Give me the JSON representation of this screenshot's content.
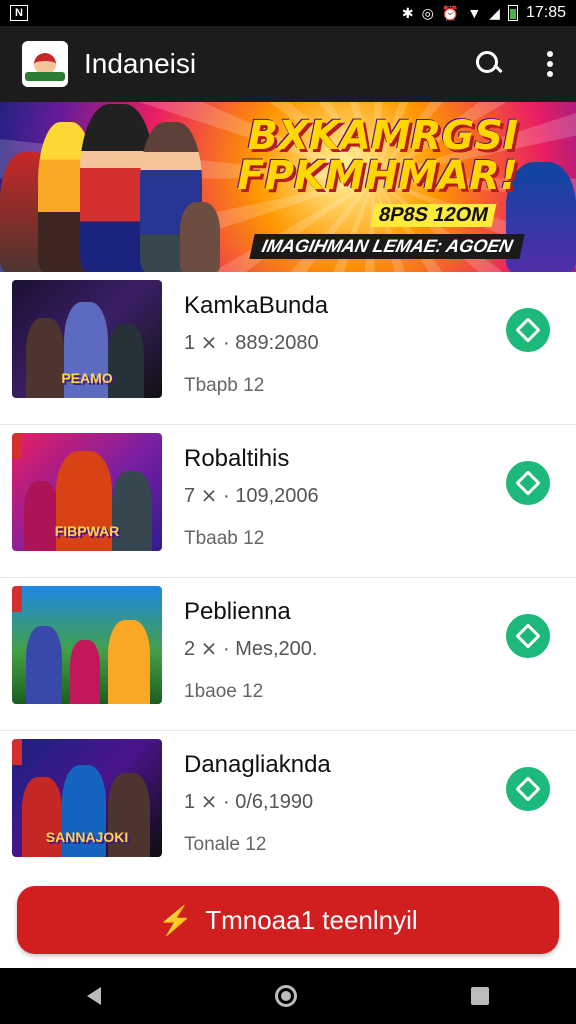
{
  "status_bar": {
    "time": "17:85",
    "notification_glyph": "N",
    "icons": [
      "bluetooth-icon",
      "vibrate-icon",
      "alarm-icon",
      "wifi-icon",
      "signal-icon",
      "battery-icon"
    ]
  },
  "app_bar": {
    "title": "Indaneisi",
    "logo": "game-logo"
  },
  "banner": {
    "title": "BXKAMRGSI FPKMHMAR!",
    "subtitle": "8P8S 12OM",
    "tagline": "IMAGIHMAN LEMAE: AGOEN"
  },
  "games": [
    {
      "title": "KamkaBunda",
      "meta": "1 ⨯ · 889:2080",
      "sub": "Tbapb 12",
      "thumb_label": "PEAMO"
    },
    {
      "title": "Robaltihis",
      "meta": "7 ⨯ · 109,2006",
      "sub": "Tbaab 12",
      "thumb_label": "FIBPWAR"
    },
    {
      "title": "Peblienna",
      "meta": "2 ⨯ · Mes,200.",
      "sub": "1baoe 12",
      "thumb_label": ""
    },
    {
      "title": "Danagliaknda",
      "meta": "1 ⨯ · 0/6,1990",
      "sub": "Tonale 12",
      "thumb_label": "SANNAJOKI"
    }
  ],
  "cta": {
    "label": "Tmnoaa1 teenlnyil",
    "icon": "lightning-icon"
  },
  "colors": {
    "accent": "#d11f1f",
    "install": "#1db97a",
    "app_bar": "#1c1c1c"
  }
}
